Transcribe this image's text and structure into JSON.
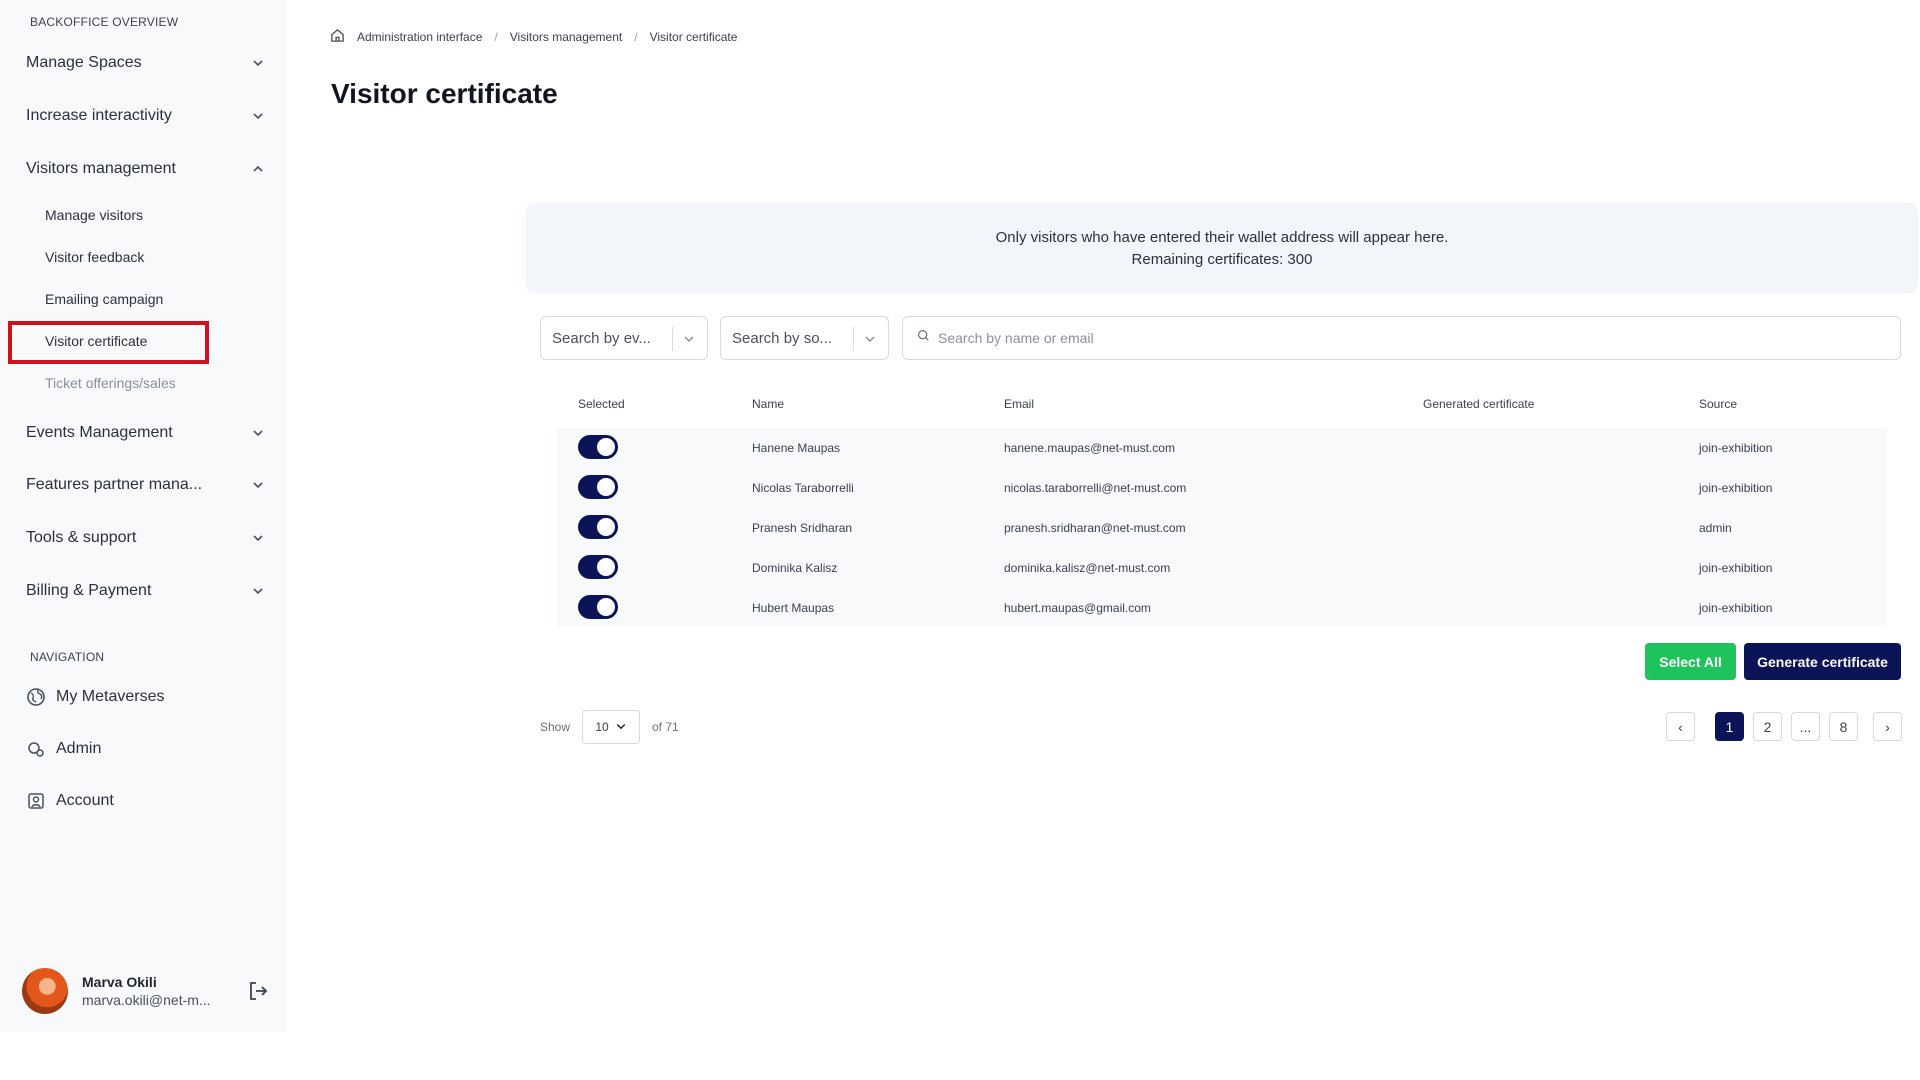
{
  "sidebar": {
    "overview_title": "BACKOFFICE OVERVIEW",
    "groups": [
      {
        "label": "Manage Spaces",
        "expanded": false
      },
      {
        "label": "Increase interactivity",
        "expanded": false
      },
      {
        "label": "Visitors management",
        "expanded": true
      },
      {
        "label": "Events Management",
        "expanded": false
      },
      {
        "label": "Features partner mana...",
        "expanded": false
      },
      {
        "label": "Tools & support",
        "expanded": false
      },
      {
        "label": "Billing & Payment",
        "expanded": false
      }
    ],
    "visitors_submenu": [
      {
        "label": "Manage visitors"
      },
      {
        "label": "Visitor feedback"
      },
      {
        "label": "Emailing campaign"
      },
      {
        "label": "Visitor certificate",
        "active": true
      },
      {
        "label": "Ticket offerings/sales",
        "muted": true
      }
    ],
    "navigation_title": "NAVIGATION",
    "navigation": [
      {
        "label": "My Metaverses",
        "icon": "globe-icon"
      },
      {
        "label": "Admin",
        "icon": "admin-icon"
      },
      {
        "label": "Account",
        "icon": "account-icon"
      }
    ],
    "user": {
      "name": "Marva Okili",
      "email": "marva.okili@net-m..."
    }
  },
  "breadcrumb": [
    "Administration interface",
    "Visitors management",
    "Visitor certificate"
  ],
  "page_title": "Visitor certificate",
  "banner": {
    "line1": "Only visitors who have entered their wallet address will appear here.",
    "line2": "Remaining certificates: 300"
  },
  "filters": {
    "event_select": "Search by ev...",
    "source_select": "Search by so...",
    "search_placeholder": "Search by name or email"
  },
  "table": {
    "headers": [
      "Selected",
      "Name",
      "Email",
      "Generated certificate",
      "Source"
    ],
    "rows": [
      {
        "selected": true,
        "name": "Hanene Maupas",
        "email": "hanene.maupas@net-must.com",
        "certificate": "",
        "source": "join-exhibition"
      },
      {
        "selected": true,
        "name": "Nicolas Taraborrelli",
        "email": "nicolas.taraborrelli@net-must.com",
        "certificate": "",
        "source": "join-exhibition"
      },
      {
        "selected": true,
        "name": "Pranesh Sridharan",
        "email": "pranesh.sridharan@net-must.com",
        "certificate": "",
        "source": "admin"
      },
      {
        "selected": true,
        "name": "Dominika Kalisz",
        "email": "dominika.kalisz@net-must.com",
        "certificate": "",
        "source": "join-exhibition"
      },
      {
        "selected": true,
        "name": "Hubert Maupas",
        "email": "hubert.maupas@gmail.com",
        "certificate": "",
        "source": "join-exhibition"
      }
    ]
  },
  "actions": {
    "select_all": "Select All",
    "generate": "Generate certificate"
  },
  "pagination": {
    "show_label": "Show",
    "page_size": "10",
    "of_label": "of 71",
    "prev": "‹",
    "pages": [
      "1",
      "2",
      "...",
      "8"
    ],
    "active_page": "1",
    "next": "›"
  },
  "colors": {
    "navy": "#0b1456",
    "green": "#1ec35c",
    "highlight": "#d0111b"
  }
}
